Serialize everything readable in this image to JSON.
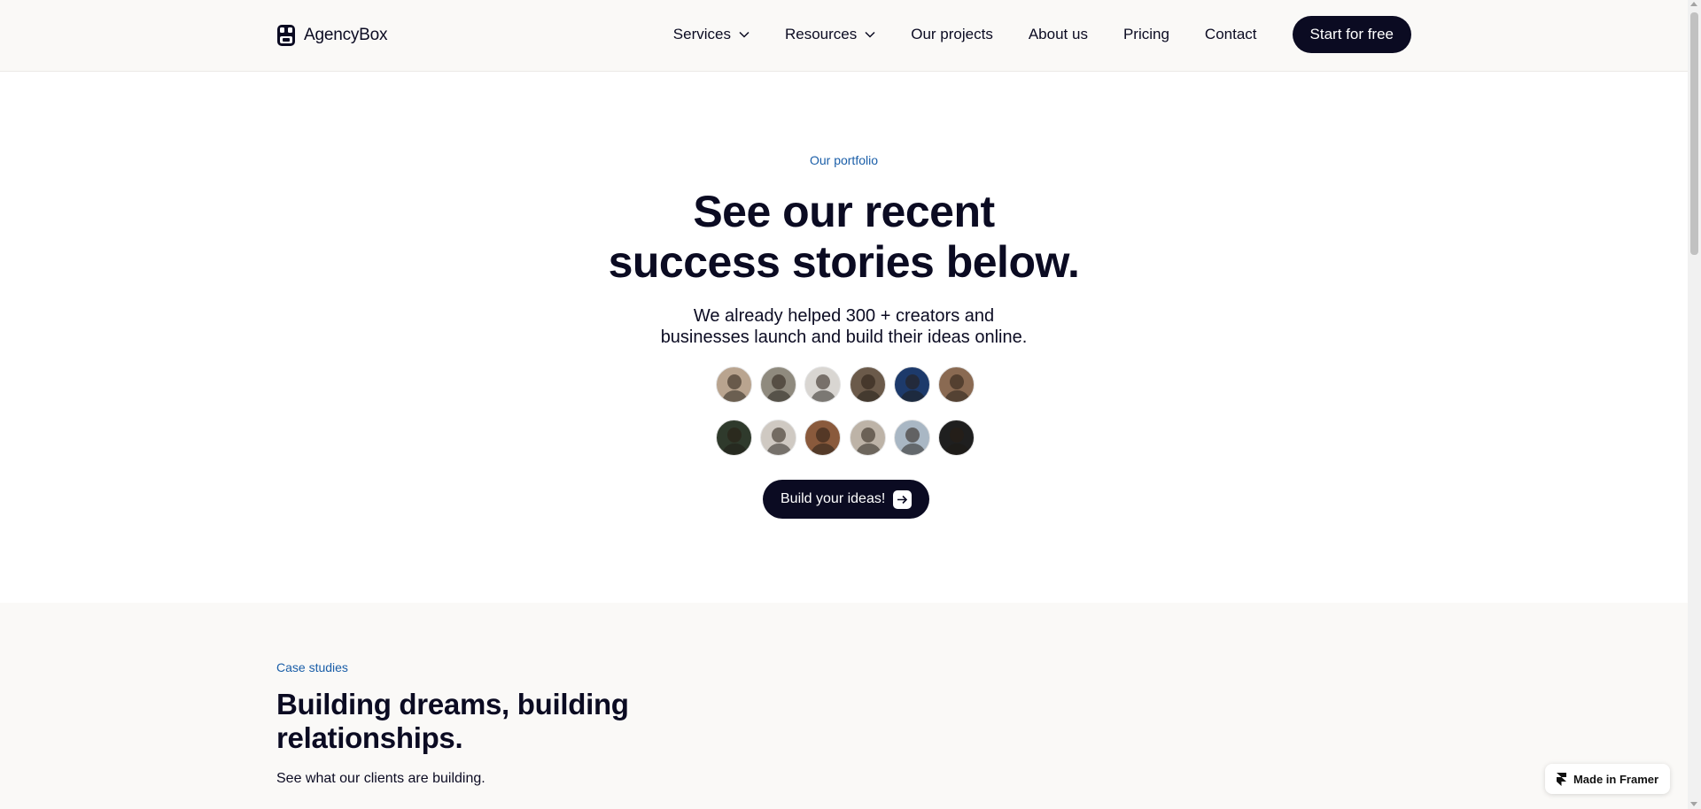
{
  "header": {
    "brand": "AgencyBox",
    "nav": [
      {
        "label": "Services",
        "dropdown": true
      },
      {
        "label": "Resources",
        "dropdown": true
      },
      {
        "label": "Our projects"
      },
      {
        "label": "About us"
      },
      {
        "label": "Pricing"
      },
      {
        "label": "Contact"
      }
    ],
    "cta": "Start for free"
  },
  "hero": {
    "eyebrow": "Our portfolio",
    "title_line1": "See our recent",
    "title_line2": "success stories below.",
    "subtitle_line1": "We already helped 300 + creators and",
    "subtitle_line2": "businesses launch and build their ideas online.",
    "avatar_colors_row1": [
      "#b9a48f",
      "#8f8a7e",
      "#d9d6d2",
      "#6b5a4a",
      "#1d3a6b",
      "#8a6a52"
    ],
    "avatar_colors_row2": [
      "#2f3a2c",
      "#cfc9c2",
      "#8a5a3c",
      "#bdb3a7",
      "#a9b7c4",
      "#1f1f1f"
    ],
    "cta": "Build your ideas!"
  },
  "case_studies": {
    "eyebrow": "Case studies",
    "title": "Building dreams, building relationships.",
    "subtitle": "See what our clients are building."
  },
  "badge": {
    "label": "Made in Framer"
  },
  "colors": {
    "accent": "#1a5ea8",
    "dark": "#0b0b22",
    "section_bg": "#faf9f7"
  },
  "icons": {
    "brand": "robot-logo-icon",
    "dropdown": "chevron-down-icon",
    "arrow": "arrow-right-icon",
    "framer": "framer-logo-icon"
  }
}
